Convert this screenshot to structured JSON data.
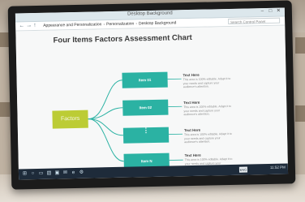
{
  "window": {
    "title": "Desktop Background"
  },
  "navbar": {
    "back_icon": "back-arrow-icon",
    "forward_icon": "forward-arrow-icon",
    "up_icon": "up-arrow-icon",
    "breadcrumb": [
      "Appearance and Personalization",
      "Personalization",
      "Desktop Background"
    ],
    "search_placeholder": "Search Control Panel"
  },
  "chart": {
    "title": "Four Items Factors Assessment Chart",
    "root_label": "Factors",
    "items": [
      {
        "label": "Item 01",
        "desc_title": "Text Here",
        "desc_body": "This area is 100% editable. Adapt it to your needs and capture your audience's attention."
      },
      {
        "label": "Item 02",
        "desc_title": "Text Here",
        "desc_body": "This area is 100% editable. Adapt it to your needs and capture your audience's attention."
      },
      {
        "label": "⋮",
        "desc_title": "Text Here",
        "desc_body": "This area is 100% editable. Adapt it to your needs and capture your audience's attention."
      },
      {
        "label": "Item N",
        "desc_title": "Text Here",
        "desc_body": "This area is 100% editable. Adapt it to your needs and capture your audience's attention."
      }
    ],
    "colors": {
      "root": "#bccc35",
      "items": "#2bb2a3",
      "links": "#2bb2a3"
    }
  },
  "taskbar": {
    "icons": [
      "start-icon",
      "search-icon",
      "task-view-icon",
      "file-explorer-icon",
      "store-icon",
      "mail-icon",
      "edge-icon",
      "settings-icon"
    ],
    "language": "ENG",
    "time": "11:52 PM"
  }
}
